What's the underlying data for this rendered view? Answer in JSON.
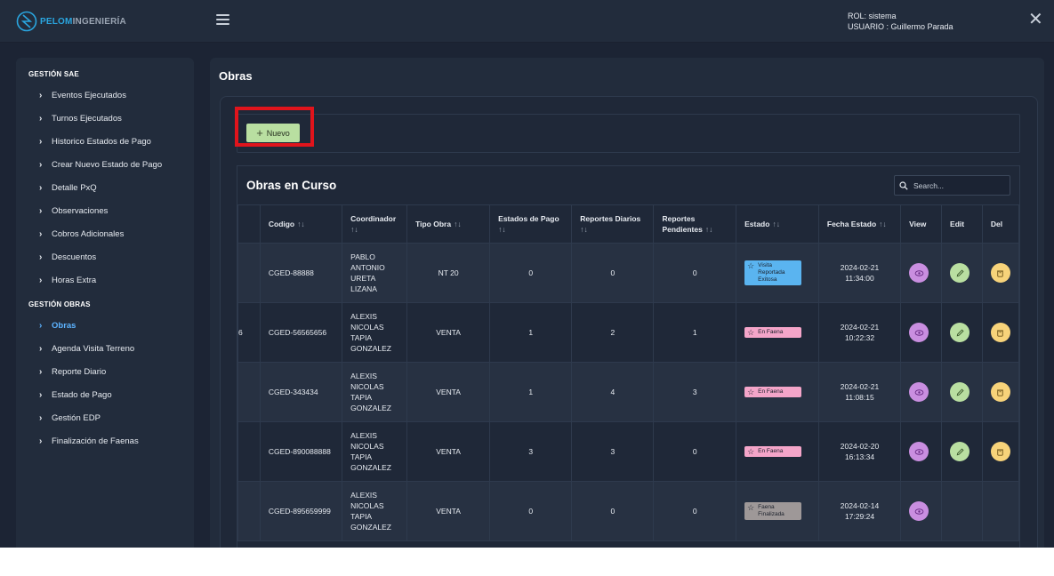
{
  "brand": {
    "part1": "PELOM",
    "part2": "INGENIERÍA"
  },
  "user": {
    "rol": "ROL: sistema",
    "usuario": "USUARIO : Guillermo Parada"
  },
  "sidebar": {
    "groups": [
      {
        "title": "GESTIÓN SAE",
        "items": [
          "Eventos Ejecutados",
          "Turnos Ejecutados",
          "Historico Estados de Pago",
          "Crear Nuevo Estado de Pago",
          "Detalle PxQ",
          "Observaciones",
          "Cobros Adicionales",
          "Descuentos",
          "Horas Extra"
        ]
      },
      {
        "title": "GESTIÓN OBRAS",
        "items": [
          "Obras",
          "Agenda Visita Terreno",
          "Reporte Diario",
          "Estado de Pago",
          "Gestión EDP",
          "Finalización de Faenas"
        ]
      }
    ],
    "active": "Obras"
  },
  "page": {
    "title": "Obras"
  },
  "toolbar": {
    "nuevo_label": "Nuevo"
  },
  "table": {
    "title": "Obras en Curso",
    "search_placeholder": "Search...",
    "headers": {
      "codigo": "Codigo",
      "coordinador": "Coordinador",
      "tipo": "Tipo Obra",
      "estados_pago": "Estados de Pago",
      "reportes_diarios": "Reportes Diarios",
      "reportes_pendientes": "Reportes Pendientes",
      "estado": "Estado",
      "fecha_estado": "Fecha Estado",
      "view": "View",
      "edit": "Edit",
      "del": "Del"
    },
    "rows": [
      {
        "partial": "",
        "codigo": "CGED-88888",
        "coordinador": "PABLO ANTONIO URETA LIZANA",
        "tipo": "NT 20",
        "estados_pago": "0",
        "reportes_diarios": "0",
        "reportes_pendientes": "0",
        "estado": "Visita Reportada Exitosa",
        "estado_color": "#5ab4f0",
        "fecha": "2024-02-21",
        "hora": "11:34:00",
        "edit": true,
        "del": true
      },
      {
        "partial": "6",
        "codigo": "CGED-56565656",
        "coordinador": "ALEXIS NICOLAS TAPIA GONZALEZ",
        "tipo": "VENTA",
        "estados_pago": "1",
        "reportes_diarios": "2",
        "reportes_pendientes": "1",
        "estado": "En Faena",
        "estado_color": "#f4a5c9",
        "fecha": "2024-02-21",
        "hora": "10:22:32",
        "edit": true,
        "del": true
      },
      {
        "partial": "",
        "codigo": "CGED-343434",
        "coordinador": "ALEXIS NICOLAS TAPIA GONZALEZ",
        "tipo": "VENTA",
        "estados_pago": "1",
        "reportes_diarios": "4",
        "reportes_pendientes": "3",
        "estado": "En Faena",
        "estado_color": "#f4a5c9",
        "fecha": "2024-02-21",
        "hora": "11:08:15",
        "edit": true,
        "del": true
      },
      {
        "partial": "",
        "codigo": "CGED-890088888",
        "coordinador": "ALEXIS NICOLAS TAPIA GONZALEZ",
        "tipo": "VENTA",
        "estados_pago": "3",
        "reportes_diarios": "3",
        "reportes_pendientes": "0",
        "estado": "En Faena",
        "estado_color": "#f4a5c9",
        "fecha": "2024-02-20",
        "hora": "16:13:34",
        "edit": true,
        "del": true
      },
      {
        "partial": "",
        "codigo": "CGED-895659999",
        "coordinador": "ALEXIS NICOLAS TAPIA GONZALEZ",
        "tipo": "VENTA",
        "estados_pago": "0",
        "reportes_diarios": "0",
        "reportes_pendientes": "0",
        "estado": "Faena Finalizada",
        "estado_color": "#9e9898",
        "fecha": "2024-02-14",
        "hora": "17:29:24",
        "edit": false,
        "del": false
      }
    ]
  },
  "colors": {
    "view_btn": "#c98ee0",
    "edit_btn": "#b9dfa1",
    "del_btn": "#f7d37a",
    "active_link": "#5cb3ff",
    "highlight_box": "#e0141c"
  }
}
